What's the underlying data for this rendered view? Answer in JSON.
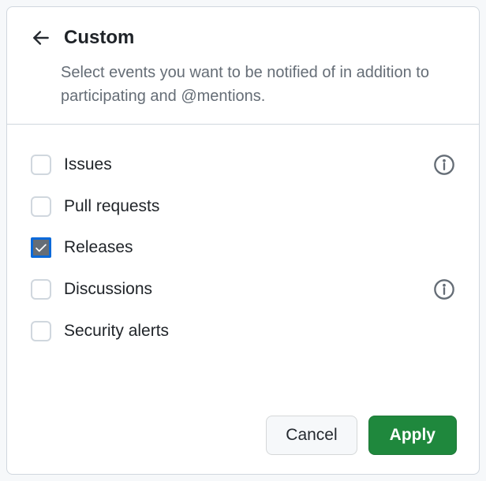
{
  "header": {
    "title": "Custom",
    "subtitle": "Select events you want to be notified of in addition to participating and @mentions."
  },
  "options": [
    {
      "label": "Issues",
      "checked": false,
      "info": true
    },
    {
      "label": "Pull requests",
      "checked": false,
      "info": false
    },
    {
      "label": "Releases",
      "checked": true,
      "info": false
    },
    {
      "label": "Discussions",
      "checked": false,
      "info": true
    },
    {
      "label": "Security alerts",
      "checked": false,
      "info": false
    }
  ],
  "footer": {
    "cancel": "Cancel",
    "apply": "Apply"
  }
}
